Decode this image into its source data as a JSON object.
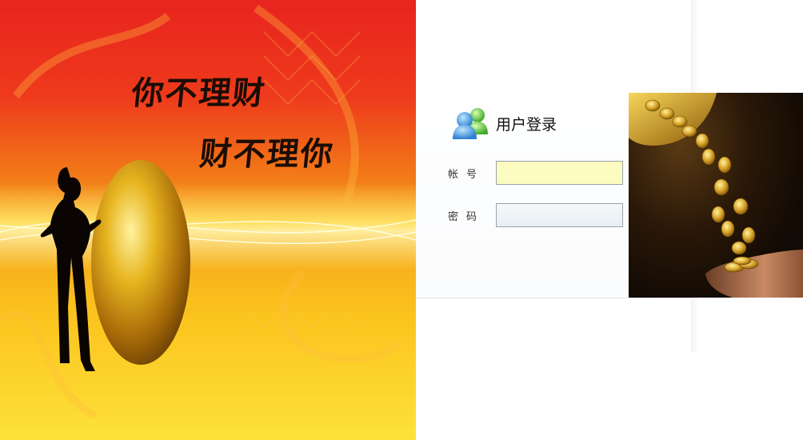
{
  "banner": {
    "slogan_line1": "你不理财",
    "slogan_line2": "财不理你"
  },
  "login": {
    "title": "用户登录",
    "account_label": "帐号",
    "password_label": "密码",
    "account_value": "",
    "password_value": ""
  },
  "icons": {
    "users": "users-icon"
  },
  "colors": {
    "banner_top": "#e8241e",
    "banner_bottom": "#fde23a",
    "account_input_bg": "#fdfcc0",
    "password_input_bg": "#e7eef2"
  }
}
